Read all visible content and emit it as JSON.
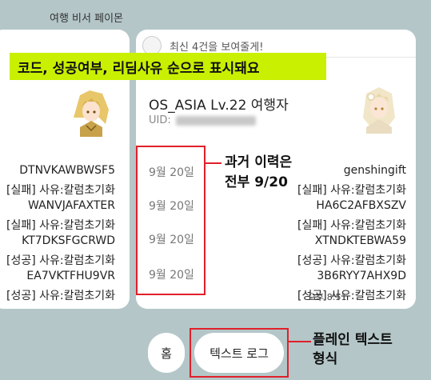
{
  "sender_name": "여행 비서 페이몬",
  "main_card": {
    "header_text": "최신 4건을 보여줄게!",
    "profile_title": "OS_ASIA Lv.22 여행자",
    "uid_label": "UID:",
    "dates": [
      "9월 20일",
      "9월 20일",
      "9월 20일",
      "9월 20일"
    ],
    "entries": [
      {
        "code": "genshingift",
        "status": "[실패] 사유:칼럼초기화"
      },
      {
        "code": "HA6C2AFBXSZV",
        "status": "[실패] 사유:칼럼초기화"
      },
      {
        "code": "XTNDKTEBWA59",
        "status": "[성공] 사유:칼럼초기화"
      },
      {
        "code": "3B6RYY7AHX9D",
        "status": "[성공] 사유:칼럼초기화"
      }
    ]
  },
  "left_card": {
    "entries": [
      {
        "code": "DTNVKAWBWSF5",
        "status": "[실패] 사유:칼럼초기화"
      },
      {
        "code": "WANVJAFAXTER",
        "status": "[실패] 사유:칼럼초기화"
      },
      {
        "code": "KT7DKSFGCRWD",
        "status": "[성공] 사유:칼럼초기화"
      },
      {
        "code": "EA7VKTFHU9VR",
        "status": "[성공] 사유:칼럼초기화"
      }
    ]
  },
  "annotations": {
    "banner": "코드, 성공여부, 리딤사유 순으로 표시돼요",
    "history_line1": "과거 이력은",
    "history_line2": "전부 9/20",
    "plain_line1": "플레인 텍스트",
    "plain_line2": "형식"
  },
  "message_time": "오후 8:51",
  "quick_replies": {
    "home_label": "홈",
    "text_log_label": "텍스트 로그"
  },
  "colors": {
    "background": "#b4c6c8",
    "highlight": "#c8f000",
    "annotation_red": "#e0202a"
  }
}
